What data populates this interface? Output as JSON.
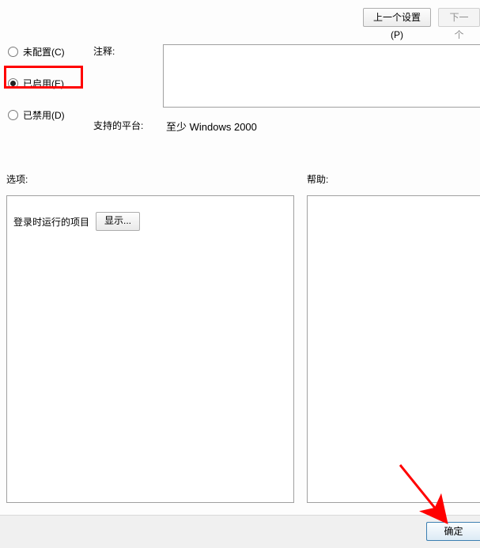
{
  "nav": {
    "prev": "上一个设置(P)",
    "next": "下一个"
  },
  "state_radios": {
    "not_configured": "未配置(C)",
    "enabled": "已启用(E)",
    "disabled": "已禁用(D)",
    "selected": "enabled"
  },
  "labels": {
    "comment": "注释:",
    "supported_platform": "支持的平台:",
    "options": "选项:",
    "help": "帮助:"
  },
  "values": {
    "comment_text": "",
    "supported_platform": "至少 Windows 2000"
  },
  "options_panel": {
    "run_items_label": "登录时运行的项目",
    "show_button": "显示..."
  },
  "help_panel": {
    "text": ""
  },
  "footer": {
    "ok": "确定"
  },
  "annotation": {
    "highlight_target": "enabled-radio",
    "arrow_target": "ok-button"
  }
}
